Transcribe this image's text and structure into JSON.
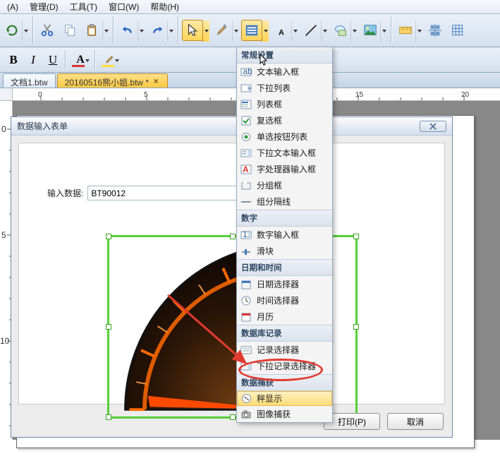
{
  "menu": {
    "items": [
      "(A)",
      "管理(D)",
      "工具(T)",
      "窗口(W)",
      "帮助(H)"
    ]
  },
  "toolbar2": {
    "bold": "B",
    "italic": "I",
    "underline": "U"
  },
  "tabs": {
    "t1": "文档1.btw",
    "t2": "20160516熊小姐.btw * "
  },
  "ruler": {
    "n0": "0",
    "n5": "5",
    "n10": "10",
    "n15": "15",
    "n20": "20"
  },
  "ruler_v": {
    "n0": "0",
    "n5": "5",
    "n10": "10"
  },
  "dialog": {
    "title": "数据输入表单",
    "input_label": "输入数据:",
    "input_value": "BT90012",
    "print": "打印(P)",
    "cancel": "取消"
  },
  "dropdown": {
    "g1": "常规设置",
    "i_text": "文本输入框",
    "i_dropdown": "下拉列表",
    "i_listbox": "列表框",
    "i_checkbox": "复选框",
    "i_radio": "单选按钮列表",
    "i_textdrop": "下拉文本输入框",
    "i_wordproc": "字处理器输入框",
    "i_group": "分组框",
    "i_sepline": "组分隔线",
    "g2": "数字",
    "i_numinput": "数字输入框",
    "i_slider": "滑块",
    "g3": "日期和时间",
    "i_datepick": "日期选择器",
    "i_timepick": "时间选择器",
    "i_calendar": "月历",
    "g4": "数据库记录",
    "i_recpick": "记录选择器",
    "i_recdrop": "下拉记录选择器",
    "g5": "数据捕获",
    "i_scale": "秤显示",
    "i_imgcap": "图像捕获"
  }
}
